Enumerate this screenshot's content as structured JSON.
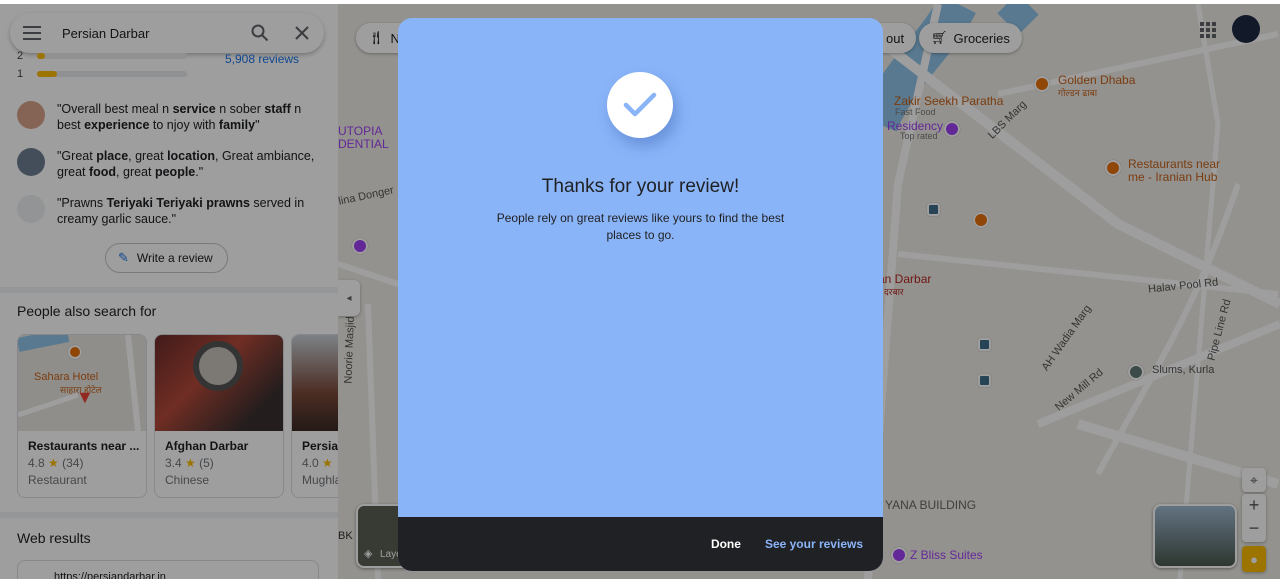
{
  "search": {
    "query": "Persian Darbar"
  },
  "ratings": {
    "rows": [
      {
        "star": "2",
        "fill": 0.05
      },
      {
        "star": "1",
        "fill": 0.13
      }
    ],
    "reviews_link": "5,908 reviews"
  },
  "snippets": [
    {
      "parts": [
        "\"Overall best meal n ",
        "service",
        " n sober ",
        "staff",
        " n best ",
        "experience",
        " to njoy with ",
        "family",
        "\""
      ]
    },
    {
      "parts": [
        "\"Great ",
        "place",
        ", great ",
        "location",
        ", Great ambiance, great ",
        "food",
        ", great ",
        "people",
        ".\""
      ]
    },
    {
      "parts": [
        "\"Prawns ",
        "Teriyaki Teriyaki prawns",
        " served in creamy garlic sauce.\""
      ]
    }
  ],
  "write_review": "Write a review",
  "also_search": {
    "title": "People also search for",
    "cards": [
      {
        "name": "Restaurants near ...",
        "rating": "4.8",
        "count": "(34)",
        "category": "Restaurant",
        "map_label": "Sahara Hotel",
        "map_label_2": "साहारा होटेल"
      },
      {
        "name": "Afghan Darbar",
        "rating": "3.4",
        "count": "(5)",
        "category": "Chinese"
      },
      {
        "name": "Persia",
        "rating": "4.0",
        "count": "",
        "category": "Mughla"
      }
    ]
  },
  "web_results": {
    "title": "Web results",
    "first_url": "https://persiandarbar.in"
  },
  "map": {
    "chips": [
      "Ne",
      "out",
      "Groceries"
    ],
    "labels": {
      "golden_dhaba": "Golden Dhaba",
      "golden_dhaba_local": "गोल्डन ढाबा",
      "zakir": "Zakir Seekh Paratha",
      "zakir_sub": "Fast Food",
      "residency": "Residency",
      "residency_sub": "Top rated",
      "restaurants_near_1": "Restaurants near",
      "restaurants_near_2": "me - Iranian Hub",
      "lbs_marg": "LBS Marg",
      "halav_pool": "Halav Pool Rd",
      "pipe_line": "Pipe Line Rd",
      "ah_wadia": "AH Wadia Marg",
      "new_mill": "New Mill Rd",
      "slums": "Slums, Kurla",
      "utopia_1": "UTOPIA",
      "utopia_2": "DENTIAL",
      "lina": "lina Donger",
      "darbar": "an Darbar",
      "darbar_local": "दरबार",
      "noorie": "Noorie Masjid",
      "vyana": "YANA BUILDING",
      "zbliss": "Z Bliss Suites",
      "layers": "Laye",
      "bk": "BK"
    }
  },
  "dialog": {
    "title": "Thanks for your review!",
    "message": "People rely on great reviews like yours to find the best places to go.",
    "done": "Done",
    "see_reviews": "See your reviews"
  }
}
